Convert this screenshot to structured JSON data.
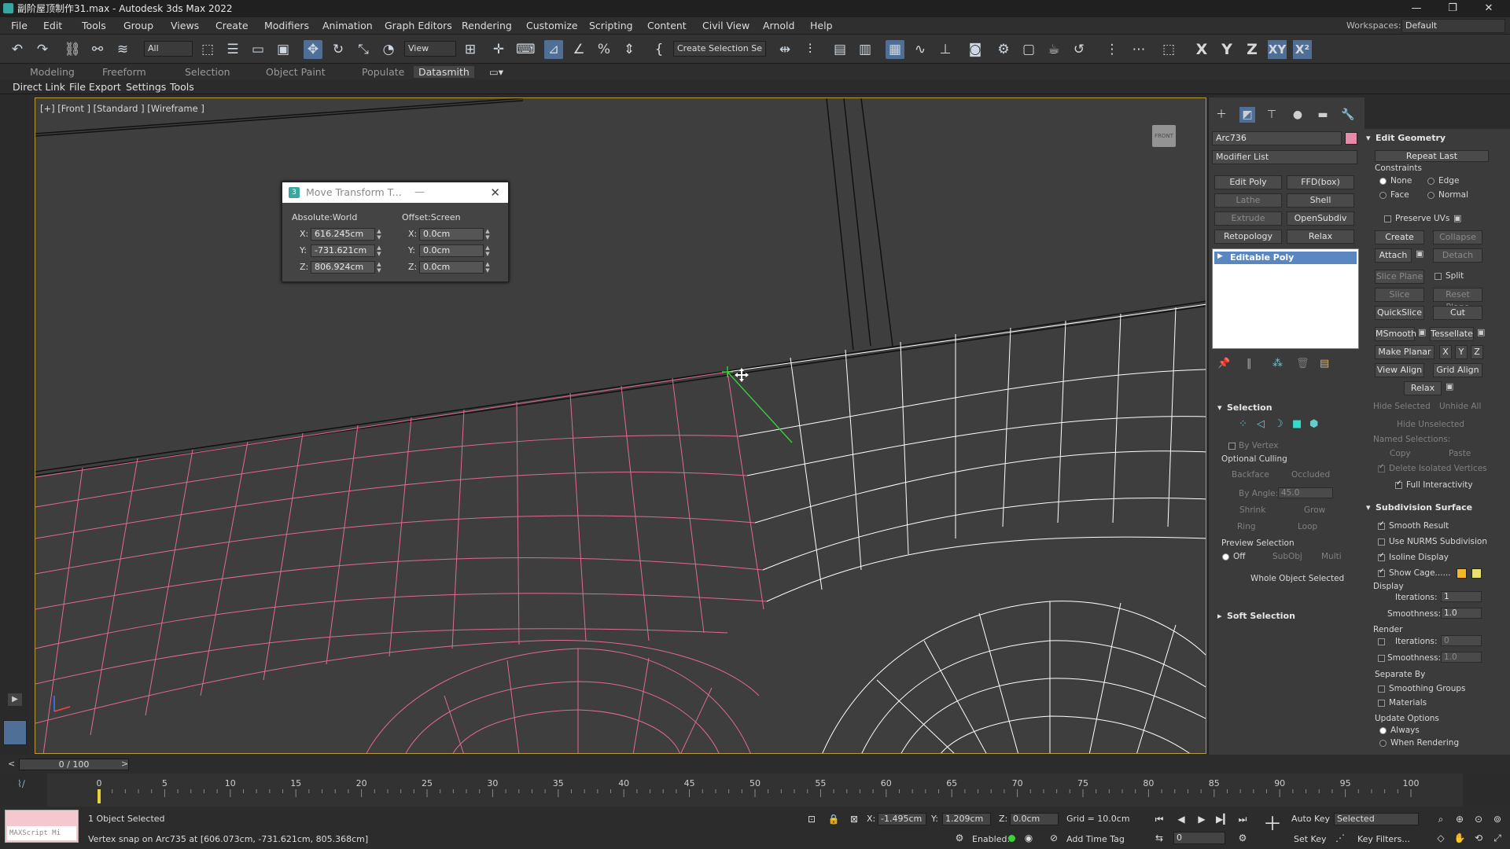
{
  "window": {
    "title": "副阶屋顶制作31.max - Autodesk 3ds Max 2022",
    "minimize": "—",
    "restore": "❐",
    "close": "✕"
  },
  "menu": [
    "File",
    "Edit",
    "Tools",
    "Group",
    "Views",
    "Create",
    "Modifiers",
    "Animation",
    "Graph Editors",
    "Rendering",
    "Customize",
    "Scripting",
    "Content",
    "Civil View",
    "Arnold",
    "Help"
  ],
  "workspace": {
    "label": "Workspaces:",
    "value": "Default"
  },
  "toolbar": {
    "selection_filter": "All",
    "ref_coord": "View",
    "named_selection": "Create Selection Se",
    "axes": [
      "X",
      "Y",
      "Z",
      "XY",
      "X²"
    ]
  },
  "ribbon": {
    "tabs": [
      "Modeling",
      "Freeform",
      "Selection",
      "Object Paint",
      "Populate",
      "Datasmith"
    ]
  },
  "datasmith": {
    "tabs": [
      "Direct Link",
      "File Export",
      "Settings",
      "Tools"
    ]
  },
  "viewport": {
    "label": "[+] [Front ] [Standard ] [Wireframe ]",
    "viewcube": "FRONT"
  },
  "dialog": {
    "title": "Move Transform T...",
    "absolute_label": "Absolute:World",
    "offset_label": "Offset:Screen",
    "abs": {
      "x": "616.245cm",
      "y": "-731.621cm",
      "z": "806.924cm"
    },
    "off": {
      "x": "0.0cm",
      "y": "0.0cm",
      "z": "0.0cm"
    }
  },
  "command_panel": {
    "object_name": "Arc736",
    "object_color": "#e58aa7",
    "modifier_list": "Modifier List",
    "modifier_buttons": [
      "Edit Poly",
      "FFD(box)",
      "Lathe",
      "Shell",
      "Extrude",
      "OpenSubdiv",
      "Retopology",
      "Relax"
    ],
    "stack_item": "Editable Poly",
    "selection": {
      "title": "Selection",
      "by_vertex": "By Vertex",
      "optional_culling": "Optional Culling",
      "backface": "Backface",
      "occluded": "Occluded",
      "by_angle": "By Angle:",
      "by_angle_value": "45.0",
      "shrink": "Shrink",
      "grow": "Grow",
      "ring": "Ring",
      "loop": "Loop",
      "preview_selection": "Preview Selection",
      "off": "Off",
      "subobj": "SubObj",
      "multi": "Multi",
      "status": "Whole Object Selected"
    },
    "soft_selection": "Soft Selection"
  },
  "edit_geometry": {
    "title": "Edit Geometry",
    "repeat_last": "Repeat Last",
    "constraints": "Constraints",
    "none": "None",
    "edge": "Edge",
    "face": "Face",
    "normal": "Normal",
    "preserve_uvs": "Preserve UVs",
    "create": "Create",
    "collapse": "Collapse",
    "attach": "Attach",
    "detach": "Detach",
    "slice_plane": "Slice Plane",
    "split": "Split",
    "slice": "Slice",
    "reset_plane": "Reset Plane",
    "quickslice": "QuickSlice",
    "cut": "Cut",
    "msmooth": "MSmooth",
    "tessellate": "Tessellate",
    "make_planar": "Make Planar",
    "x": "X",
    "y": "Y",
    "z": "Z",
    "view_align": "View Align",
    "grid_align": "Grid Align",
    "relax": "Relax",
    "hide_selected": "Hide Selected",
    "unhide_all": "Unhide All",
    "hide_unselected": "Hide Unselected",
    "named_selections": "Named Selections:",
    "copy": "Copy",
    "paste": "Paste",
    "delete_isolated": "Delete Isolated Vertices",
    "full_interactivity": "Full Interactivity"
  },
  "subdivision": {
    "title": "Subdivision Surface",
    "smooth_result": "Smooth Result",
    "use_nurms": "Use NURMS Subdivision",
    "isoline": "Isoline Display",
    "show_cage": "Show Cage......",
    "cage_color_1": "#f2b829",
    "cage_color_2": "#e8e070",
    "display": "Display",
    "iterations_label": "Iterations:",
    "iterations": "1",
    "smoothness_label": "Smoothness:",
    "smoothness": "1.0",
    "render": "Render",
    "r_iterations": "0",
    "r_smoothness": "1.0",
    "separate_by": "Separate By",
    "smoothing_groups": "Smoothing Groups",
    "materials": "Materials",
    "update_options": "Update Options",
    "always": "Always",
    "when_rendering": "When Rendering"
  },
  "timeline": {
    "frame": "0 / 100",
    "ticks": [
      "0",
      "5",
      "10",
      "15",
      "20",
      "25",
      "30",
      "35",
      "40",
      "45",
      "50",
      "55",
      "60",
      "65",
      "70",
      "75",
      "80",
      "85",
      "90",
      "95",
      "100"
    ]
  },
  "status": {
    "maxscript": "MAXScript Mi",
    "selected": "1 Object Selected",
    "prompt": "Vertex snap on Arc735 at [606.073cm, -731.621cm, 805.368cm]",
    "x_label": "X:",
    "x": "-1.495cm",
    "y_label": "Y:",
    "y": "1.209cm",
    "z_label": "Z:",
    "z": "0.0cm",
    "grid": "Grid = 10.0cm",
    "enabled": "Enabled:",
    "add_time_tag": "Add Time Tag",
    "auto_key": "Auto Key",
    "selected_dd": "Selected",
    "set_key": "Set Key",
    "key_filters": "Key Filters...",
    "frame": "0"
  }
}
